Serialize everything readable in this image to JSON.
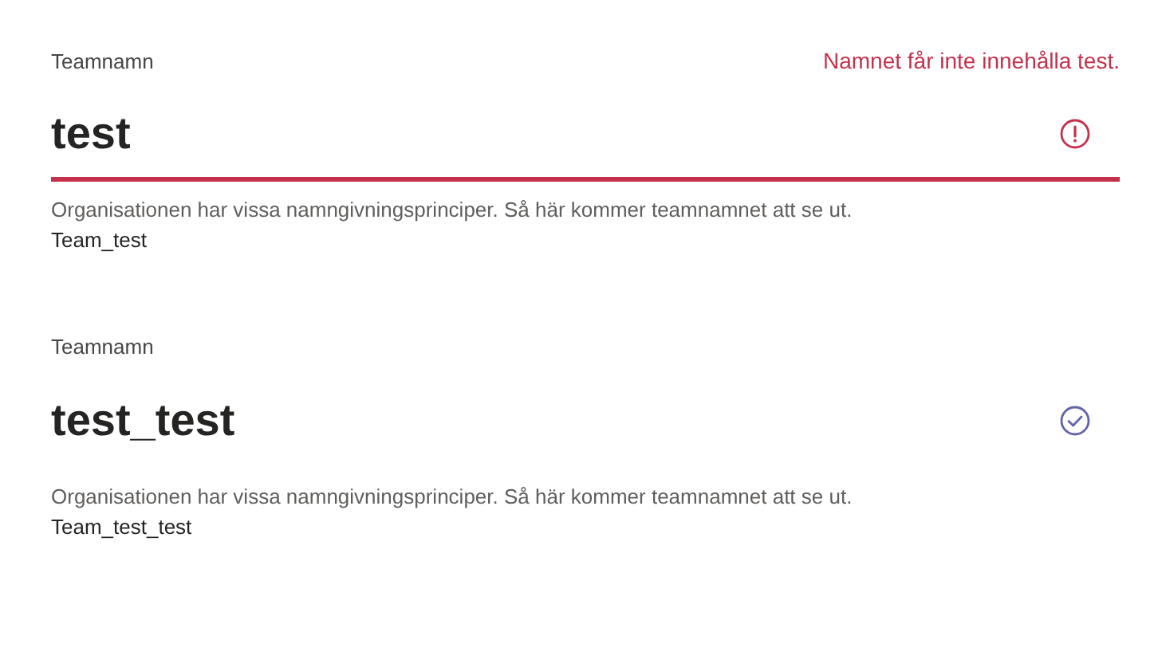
{
  "fields": [
    {
      "label": "Teamnamn",
      "error": "Namnet får inte innehålla test.",
      "value": "test",
      "kind": "error",
      "help": "Organisationen har vissa namngivningsprinciper. Så här kommer teamnamnet att se ut.",
      "preview": "Team_test"
    },
    {
      "label": "Teamnamn",
      "value": "test_test",
      "kind": "valid",
      "help": "Organisationen har vissa namngivningsprinciper. Så här kommer teamnamnet att se ut.",
      "preview": "Team_test_test"
    }
  ]
}
